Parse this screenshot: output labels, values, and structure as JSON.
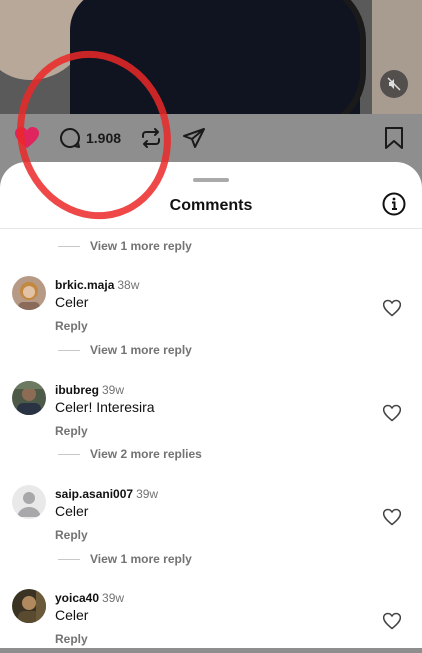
{
  "post": {
    "like_count": "1.908"
  },
  "sheet": {
    "title": "Comments"
  },
  "top_more_reply": "View 1 more reply",
  "comments": [
    {
      "username": "brkic.maja",
      "time": "38w",
      "text": "Celer",
      "reply_label": "Reply",
      "more_replies": "View 1 more reply"
    },
    {
      "username": "ibubreg",
      "time": "39w",
      "text": "Celer! Interesira",
      "reply_label": "Reply",
      "more_replies": "View 2 more replies"
    },
    {
      "username": "saip.asani007",
      "time": "39w",
      "text": "Celer",
      "reply_label": "Reply",
      "more_replies": "View 1 more reply"
    },
    {
      "username": "yoica40",
      "time": "39w",
      "text": "Celer",
      "reply_label": "Reply"
    }
  ],
  "icons": {
    "like": "heart-filled-icon",
    "comment": "comment-bubble-icon",
    "repost": "repost-icon",
    "share": "send-icon",
    "save": "bookmark-icon",
    "mute": "speaker-muted-icon",
    "info": "info-icon",
    "comment_like": "heart-outline-icon"
  },
  "colors": {
    "like_red": "#e0245e",
    "annotation_red": "#eb2828",
    "muted_text": "#737373"
  }
}
